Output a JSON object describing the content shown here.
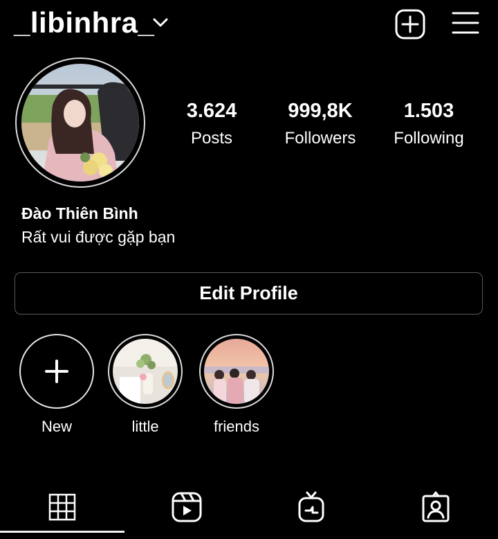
{
  "header": {
    "username": "_libinhra_"
  },
  "profile": {
    "display_name": "Đào Thiên Bình",
    "bio": "Rất vui được gặp bạn"
  },
  "stats": [
    {
      "value": "3.624",
      "label": "Posts"
    },
    {
      "value": "999,8K",
      "label": "Followers"
    },
    {
      "value": "1.503",
      "label": "Following"
    }
  ],
  "edit_profile_label": "Edit Profile",
  "highlights": [
    {
      "label": "New"
    },
    {
      "label": "little"
    },
    {
      "label": "friends"
    }
  ],
  "tabs": [
    {
      "icon": "grid-icon",
      "active": true
    },
    {
      "icon": "reels-icon",
      "active": false
    },
    {
      "icon": "igtv-icon",
      "active": false
    },
    {
      "icon": "tagged-icon",
      "active": false
    }
  ],
  "colors": {
    "background": "#000000",
    "text": "#ffffff",
    "border": "#5a5a5a",
    "ring": "#dcdcdc"
  }
}
